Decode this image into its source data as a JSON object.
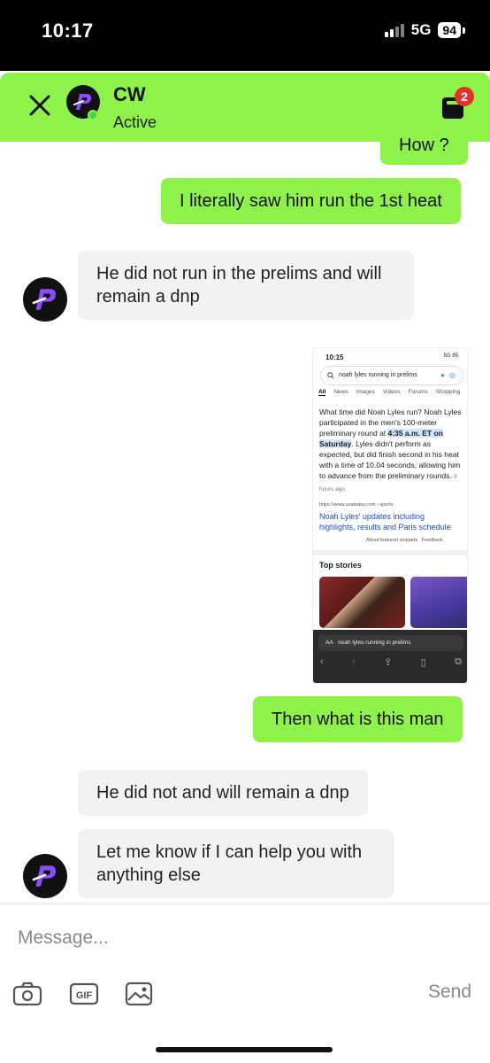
{
  "status_bar": {
    "time": "10:17",
    "network": "5G",
    "battery": "94"
  },
  "header": {
    "name": "CW",
    "status": "Active",
    "badge_count": "2"
  },
  "messages": [
    {
      "side": "sent",
      "text": "How ?"
    },
    {
      "side": "sent",
      "text": "I literally saw him run the 1st heat"
    },
    {
      "side": "received",
      "text": "He did not run in the prelims and will remain a dnp"
    },
    {
      "side": "sent",
      "type": "image"
    },
    {
      "side": "sent",
      "text": "Then what is this man"
    },
    {
      "side": "received",
      "text": "He did not and will remain a dnp"
    },
    {
      "side": "received",
      "text": "Let me know if I can help you with anything else"
    }
  ],
  "shared_screenshot": {
    "time": "10:15",
    "status_right": "5G 95",
    "query": "noah lyles running in prelims",
    "tabs": [
      "All",
      "News",
      "Images",
      "Videos",
      "Forums",
      "Shopping"
    ],
    "answer_before": "What time did Noah Lyles run? Noah Lyles participated in the men's 100-meter preliminary round at ",
    "answer_highlight": "4:35 a.m. ET on Saturday",
    "answer_after": ". Lyles didn't perform as expected, but did finish second in his heat with a time of 10.04 seconds, allowing him to advance from the preliminary rounds.",
    "answer_time": "9 hours ago",
    "source": "https://www.usatoday.com › sports",
    "link": "Noah Lyles' updates including highlights, results and Paris schedule",
    "about": "About featured snippets",
    "feedback": "Feedback",
    "top_stories": "Top stories",
    "url_bar": "noah lyles running in prelims",
    "url_aa": "AA"
  },
  "input": {
    "placeholder": "Message...",
    "send_label": "Send"
  },
  "colors": {
    "accent_green": "#8ff24a",
    "badge_red": "#e0322b",
    "bubble_gray": "#f2f2f2",
    "link_blue": "#1a4fc9"
  }
}
